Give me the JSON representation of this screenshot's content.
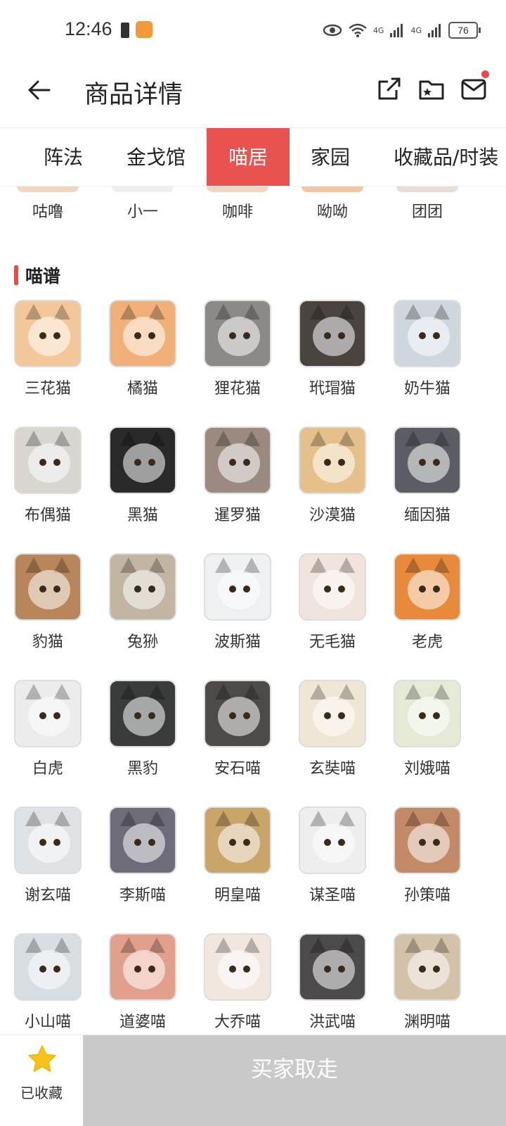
{
  "status_bar": {
    "time": "12:46",
    "signal_1": "4G",
    "signal_2": "4G",
    "battery": "76"
  },
  "header": {
    "title": "商品详情",
    "icons": [
      "back-arrow-icon",
      "share-icon",
      "folder-icon",
      "mail-icon"
    ]
  },
  "tabs": [
    {
      "label": "阵法",
      "active": false
    },
    {
      "label": "金戈馆",
      "active": false
    },
    {
      "label": "喵居",
      "active": true
    },
    {
      "label": "家园",
      "active": false
    },
    {
      "label": "收藏品/时装",
      "active": false
    }
  ],
  "previous_row": [
    "咕噜",
    "小一",
    "咖啡",
    "呦呦",
    "团团"
  ],
  "section": {
    "title": "喵谱",
    "accent_color": "#e94c48"
  },
  "cats": [
    {
      "name": "三花猫",
      "color": "#f3c79a"
    },
    {
      "name": "橘猫",
      "color": "#f1b077"
    },
    {
      "name": "狸花猫",
      "color": "#8c8a86"
    },
    {
      "name": "玳瑁猫",
      "color": "#4a4440"
    },
    {
      "name": "奶牛猫",
      "color": "#cfd6dd"
    },
    {
      "name": "布偶猫",
      "color": "#d9d6d0"
    },
    {
      "name": "黑猫",
      "color": "#2a2a2a"
    },
    {
      "name": "暹罗猫",
      "color": "#9a8a80"
    },
    {
      "name": "沙漠猫",
      "color": "#e6c08a"
    },
    {
      "name": "缅因猫",
      "color": "#5a5d63"
    },
    {
      "name": "豹猫",
      "color": "#b8865a"
    },
    {
      "name": "兔狲",
      "color": "#c2b6a2"
    },
    {
      "name": "波斯猫",
      "color": "#eef0f2"
    },
    {
      "name": "无毛猫",
      "color": "#f0e4dc"
    },
    {
      "name": "老虎",
      "color": "#e88a3c"
    },
    {
      "name": "白虎",
      "color": "#ececec"
    },
    {
      "name": "黑豹",
      "color": "#3a3c3c"
    },
    {
      "name": "安石喵",
      "color": "#4e4a48"
    },
    {
      "name": "玄奘喵",
      "color": "#efe6d6"
    },
    {
      "name": "刘娥喵",
      "color": "#e4ead6"
    },
    {
      "name": "谢玄喵",
      "color": "#dfe2e4"
    },
    {
      "name": "李斯喵",
      "color": "#6e6c78"
    },
    {
      "name": "明皇喵",
      "color": "#c9a56a"
    },
    {
      "name": "谋圣喵",
      "color": "#eeeeee"
    },
    {
      "name": "孙策喵",
      "color": "#c28a66"
    },
    {
      "name": "小山喵",
      "color": "#d8dde2"
    },
    {
      "name": "道婆喵",
      "color": "#e2a08c"
    },
    {
      "name": "大乔喵",
      "color": "#f1e7df"
    },
    {
      "name": "洪武喵",
      "color": "#4c4a4a"
    },
    {
      "name": "渊明喵",
      "color": "#d4c2a8"
    }
  ],
  "bottom_bar": {
    "favorite_label": "已收藏",
    "buy_label": "买家取走",
    "star_color": "#f7c31b",
    "button_color": "#c9c9c9"
  }
}
